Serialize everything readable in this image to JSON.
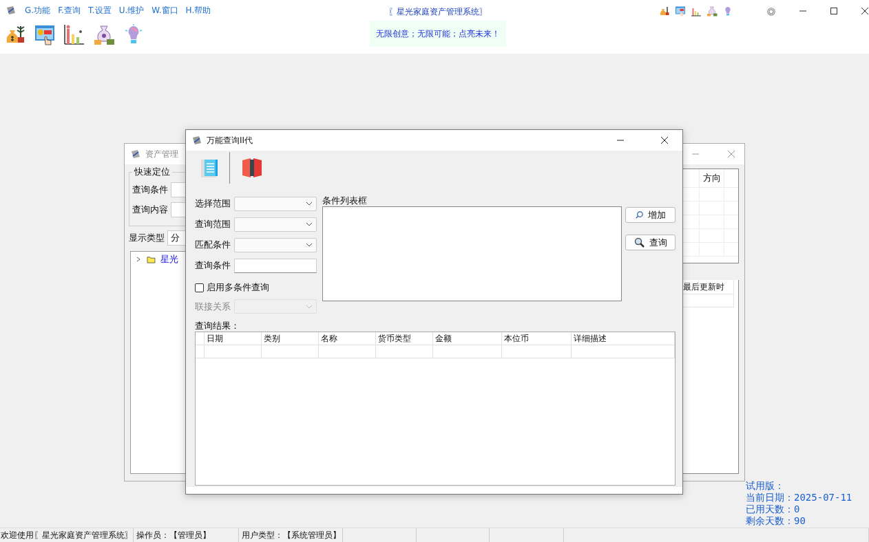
{
  "app": {
    "title": "〖星光家庭资产管理系统〗",
    "slogan": "无限创意；无限可能；点亮未来！",
    "menu": [
      "G.功能",
      "F.查询",
      "T.设置",
      "U.维护",
      "W.窗口",
      "H.帮助"
    ]
  },
  "asset_window": {
    "title": "资产管理",
    "group_title": "快速定位",
    "fields": [
      {
        "label": "查询条件"
      },
      {
        "label": "查询内容"
      }
    ],
    "display_type": {
      "label": "显示类型",
      "value": "分"
    },
    "tree": [
      {
        "label": "星光",
        "expanded": false
      }
    ],
    "grid_columns": [
      "方向"
    ],
    "panel_columns": [
      "最后更新时"
    ]
  },
  "query_dialog": {
    "title": "万能查询II代",
    "fields": [
      {
        "label": "选择范围",
        "kind": "combo"
      },
      {
        "label": "查询范围",
        "kind": "combo"
      },
      {
        "label": "匹配条件",
        "kind": "combo"
      },
      {
        "label": "查询条件",
        "kind": "text"
      }
    ],
    "multi_condition": {
      "label": "启用多条件查询",
      "checked": false
    },
    "join": {
      "label": "联接关系",
      "disabled": true
    },
    "condition_list_label": "条件列表框",
    "buttons": [
      {
        "label": "增加",
        "kind": "add"
      },
      {
        "label": "查询",
        "kind": "query"
      }
    ],
    "results_label": "查询结果：",
    "results_columns": [
      "日期",
      "类别",
      "名称",
      "货币类型",
      "金额",
      "本位币",
      "详细描述"
    ]
  },
  "trial": {
    "heading": "试用版：",
    "lines": [
      "当前日期：2025-07-11",
      "已用天数：0",
      "剩余天数：90"
    ]
  },
  "status_bar": [
    "欢迎使用〖星光家庭资产管理系统〗",
    "操作员：【管理员】",
    "用户类型：【系统管理员】"
  ]
}
